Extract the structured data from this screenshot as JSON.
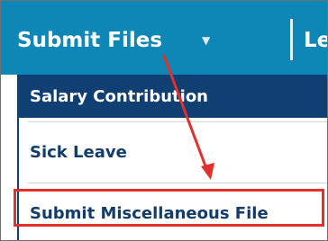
{
  "navbar": {
    "menu_label": "Submit Files",
    "next_label": "Le"
  },
  "dropdown": {
    "items": [
      {
        "label": "Salary Contribution"
      },
      {
        "label": "Sick Leave"
      },
      {
        "label": "Submit Miscellaneous File"
      }
    ]
  },
  "colors": {
    "navbar": "#0e86b6",
    "active_item": "#0f3f73",
    "callout": "#e0312f"
  },
  "icons": {
    "caret": "chevron-down-icon",
    "arrow": "callout-arrow-icon"
  }
}
